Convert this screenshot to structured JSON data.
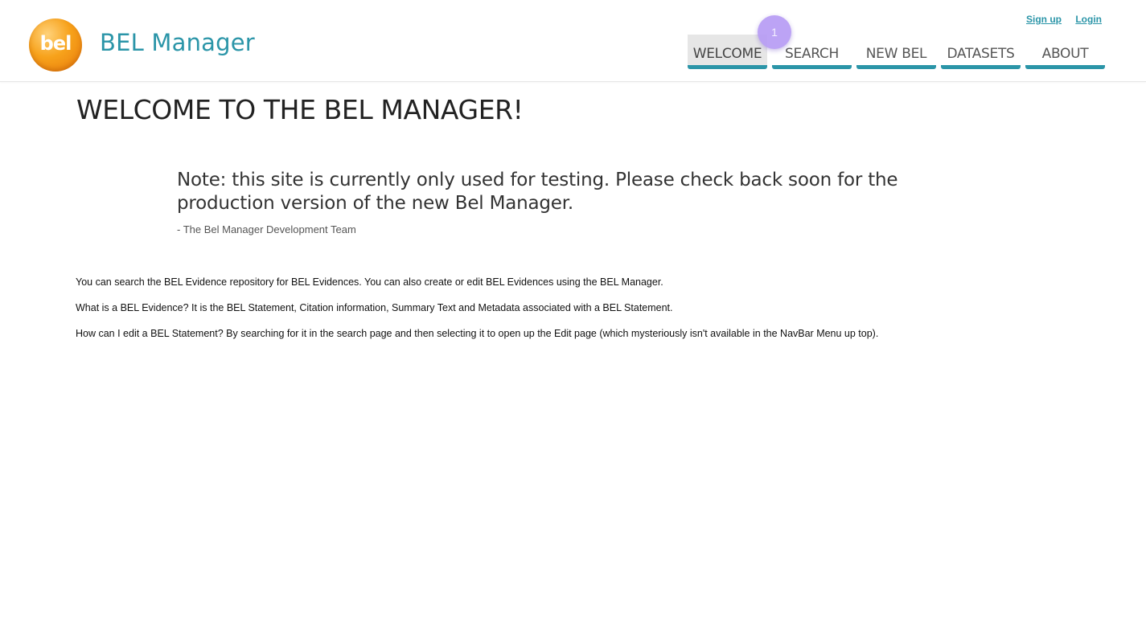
{
  "header": {
    "logo_text": "bel",
    "brand": "BEL Manager",
    "auth": {
      "signup": "Sign up",
      "login": "Login"
    },
    "nav": [
      {
        "label": "WELCOME",
        "active": true
      },
      {
        "label": "SEARCH",
        "active": false
      },
      {
        "label": "NEW BEL",
        "active": false
      },
      {
        "label": "DATASETS",
        "active": false
      },
      {
        "label": "ABOUT",
        "active": false
      }
    ],
    "step_badge": "1"
  },
  "main": {
    "title": "WELCOME TO THE BEL MANAGER!",
    "note": "Note: this site is currently only used for testing. Please check back soon for the production version of the new Bel Manager.",
    "note_signature": "- The Bel Manager Development Team",
    "paragraphs": [
      "You can search the BEL Evidence repository for BEL Evidences. You can also create or edit BEL Evidences using the BEL Manager.",
      "What is a BEL Evidence? It is the BEL Statement, Citation information, Summary Text and Metadata associated with a BEL Statement.",
      "How can I edit a BEL Statement? By searching for it in the search page and then selecting it to open up the Edit page (which mysteriously isn't available in the NavBar Menu up top)."
    ]
  },
  "colors": {
    "accent": "#2b95a8",
    "logo_orange": "#f7a21b",
    "active_tab_bg": "#e6e6e6",
    "badge": "#b79cf5"
  }
}
